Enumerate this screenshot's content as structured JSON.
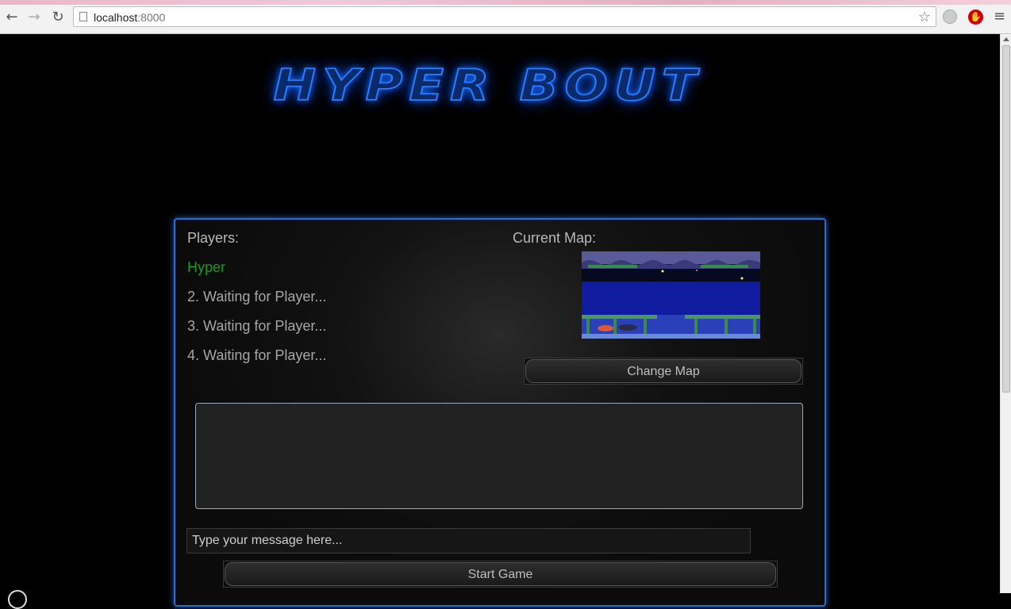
{
  "browser": {
    "url_host": "localhost",
    "url_port": ":8000"
  },
  "game": {
    "title": "HYPER BOUT"
  },
  "lobby": {
    "players_label": "Players:",
    "players": [
      "Hyper",
      "2. Waiting for Player...",
      "3. Waiting for Player...",
      "4. Waiting for Player..."
    ],
    "current_map_label": "Current Map:",
    "change_map_label": "Change Map",
    "message_placeholder": "Type your message here...",
    "start_game_label": "Start Game"
  },
  "colors": {
    "accent_blue": "#2a6cc8",
    "active_player": "#1a9a1a"
  }
}
